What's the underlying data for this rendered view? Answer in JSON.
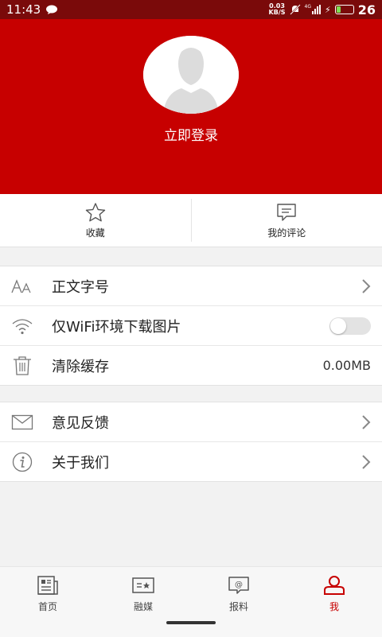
{
  "status_bar": {
    "time": "11:43",
    "net_speed_value": "0.03",
    "net_speed_unit": "KB/S",
    "network": "4G",
    "battery_level": "26"
  },
  "header": {
    "login_label": "立即登录",
    "background_color": "#c70000"
  },
  "quick_actions": [
    {
      "label": "收藏",
      "icon": "star-icon"
    },
    {
      "label": "我的评论",
      "icon": "comment-icon"
    }
  ],
  "settings_group_1": [
    {
      "label": "正文字号",
      "icon": "font-size-icon",
      "right": "chevron"
    },
    {
      "label": "仅WiFi环境下载图片",
      "icon": "wifi-icon",
      "right": "toggle",
      "toggle_on": false
    },
    {
      "label": "清除缓存",
      "icon": "trash-icon",
      "right_text": "0.00MB"
    }
  ],
  "settings_group_2": [
    {
      "label": "意见反馈",
      "icon": "mail-icon",
      "right": "chevron"
    },
    {
      "label": "关于我们",
      "icon": "info-icon",
      "right": "chevron"
    }
  ],
  "tabs": [
    {
      "label": "首页",
      "icon": "news-icon",
      "active": false
    },
    {
      "label": "融媒",
      "icon": "media-icon",
      "active": false
    },
    {
      "label": "报料",
      "icon": "report-icon",
      "active": false
    },
    {
      "label": "我",
      "icon": "user-icon",
      "active": true
    }
  ],
  "accent_color": "#c70000"
}
